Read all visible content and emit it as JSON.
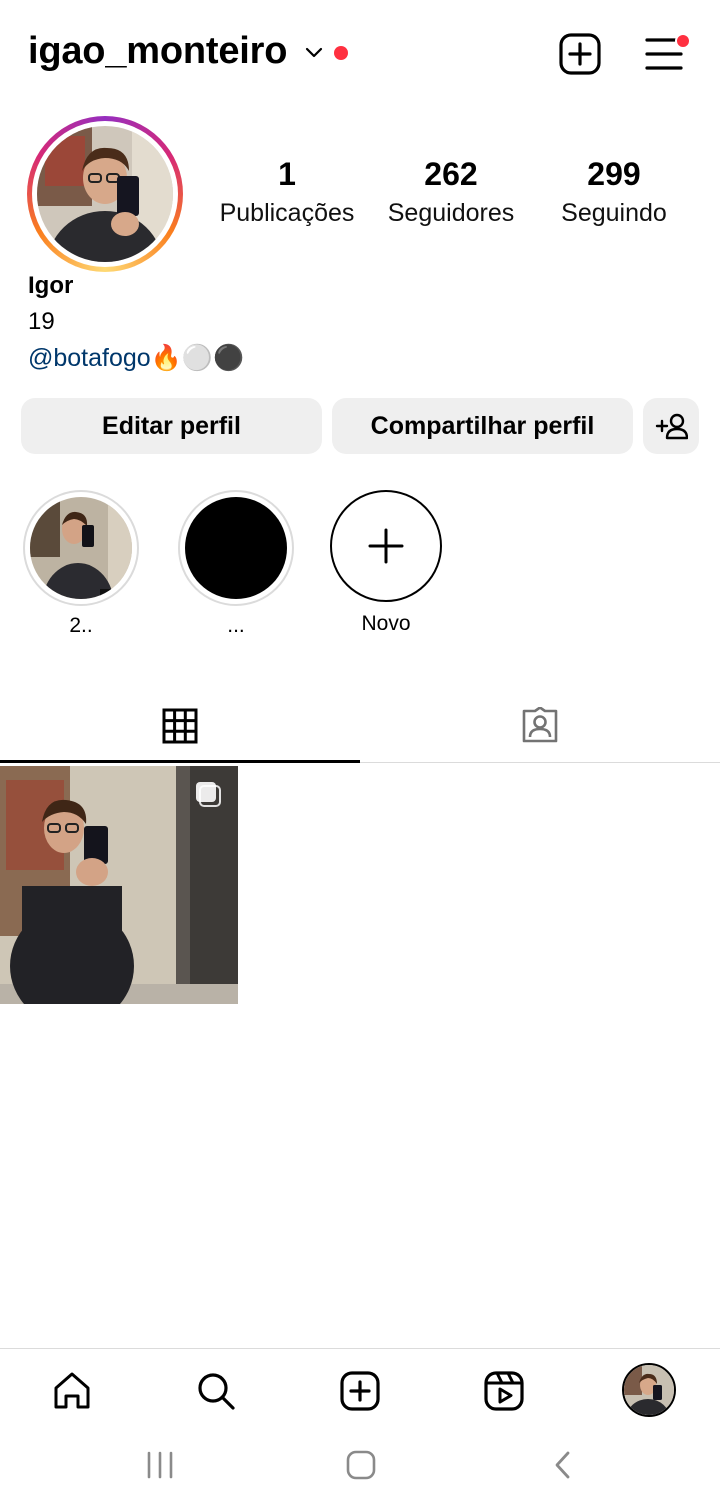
{
  "header": {
    "username": "igao_monteiro"
  },
  "profile": {
    "stats": [
      {
        "value": "1",
        "label": "Publicações"
      },
      {
        "value": "262",
        "label": "Seguidores"
      },
      {
        "value": "299",
        "label": "Seguindo"
      }
    ],
    "name": "Igor",
    "age": "19",
    "bio_tag": "@botafogo🔥⚪⚫"
  },
  "actions": {
    "edit_label": "Editar perfil",
    "share_label": "Compartilhar perfil"
  },
  "highlights": [
    {
      "label": "2.."
    },
    {
      "label": "..."
    },
    {
      "label": "Novo"
    }
  ],
  "colors": {
    "accent_red": "#ff3040",
    "link_blue": "#00376b",
    "button_bg": "#efefef"
  },
  "icons": [
    "chevron-down-icon",
    "new-post-icon",
    "menu-icon",
    "add-person-icon",
    "grid-icon",
    "tagged-icon",
    "home-icon",
    "search-icon",
    "create-icon",
    "reels-icon",
    "android-recents-icon",
    "android-home-icon",
    "android-back-icon"
  ]
}
